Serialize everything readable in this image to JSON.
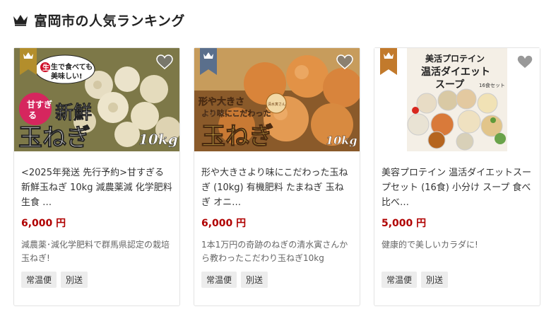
{
  "header": {
    "title": "富岡市の人気ランキング"
  },
  "colors": {
    "gold": "#b38e2c",
    "navy": "#5a6f8c",
    "bronze": "#c27a2c",
    "price": "#b00000",
    "tag_bg": "#ececec"
  },
  "cards": [
    {
      "rank": "1",
      "name": "<2025年発送 先行予約>甘すぎる新鮮玉ねぎ 10kg 減農薬減 化学肥料 生食 …",
      "price": "6,000 円",
      "desc": "減農薬･減化学肥料で群馬県認定の栽培玉ねぎ!",
      "tags": [
        "常温便",
        "別送"
      ],
      "image_text": {
        "bubble1": "生で食べても",
        "bubble2": "美味しい!",
        "badge1": "甘すぎ",
        "badge2": "る",
        "main1": "新鮮",
        "main2": "玉ねぎ",
        "weight": "10kg"
      }
    },
    {
      "rank": "2",
      "name": "形や大きさより味にこだわった玉ねぎ (10kg) 有機肥料 たまねぎ 玉ねぎ オニ…",
      "price": "6,000 円",
      "desc": "1本1万円の奇跡のねぎの清水寅さんから教わったこだわり玉ねぎ10kg",
      "tags": [
        "常温便",
        "別送"
      ],
      "image_text": {
        "line1": "形や大きさ",
        "line2": "より味にこだわった",
        "main": "玉ねぎ",
        "weight": "10kg",
        "seal": "清水寅さん"
      }
    },
    {
      "rank": "3",
      "name": "美容プロテイン 温活ダイエットスープセット (16食) 小分け スープ 食べ比べ…",
      "price": "5,000 円",
      "desc": "健康的で美しいカラダに!",
      "tags": [
        "常温便",
        "別送"
      ],
      "image_text": {
        "line1": "美活プロテイン",
        "line2": "温活ダイエット",
        "line3": "スープ",
        "sub": "16食セット"
      }
    }
  ]
}
